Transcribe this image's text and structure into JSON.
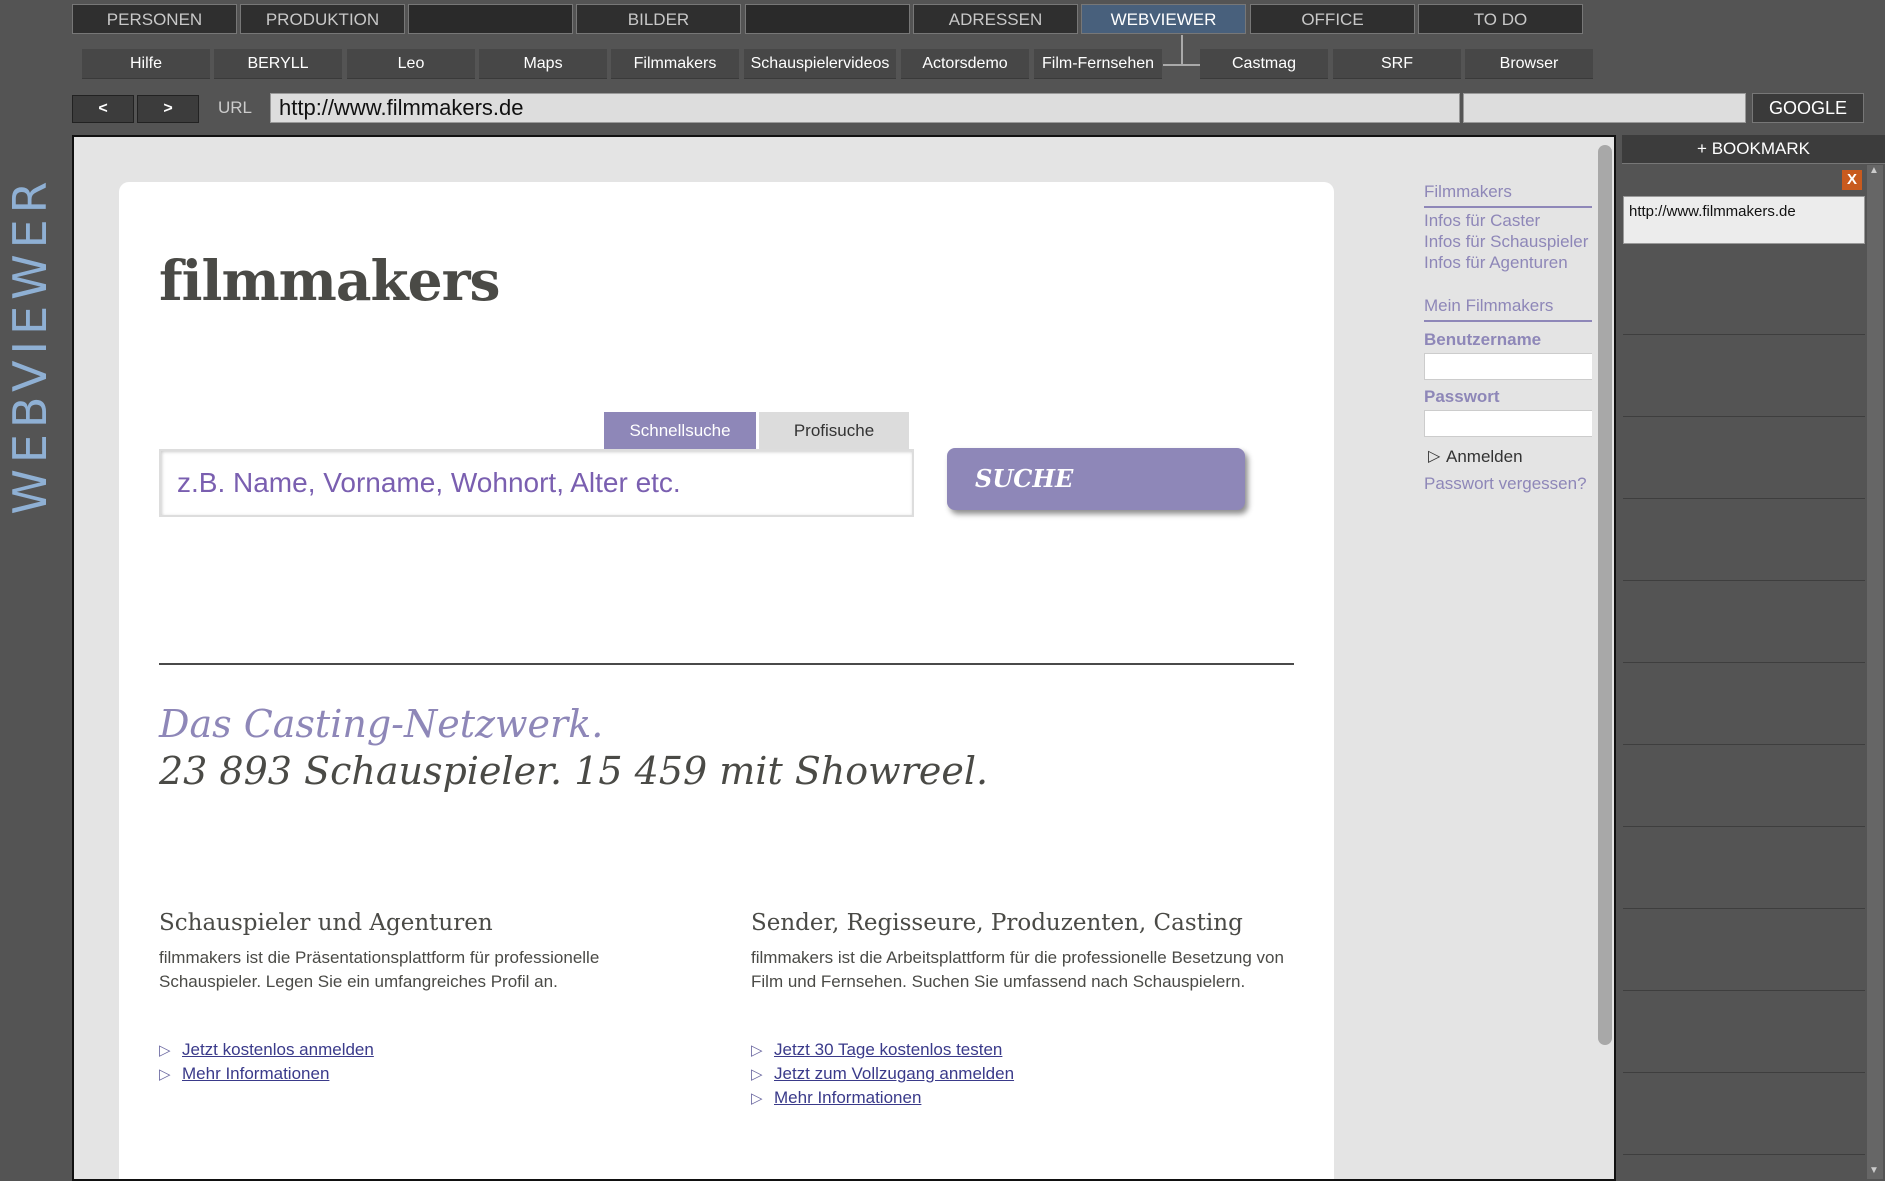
{
  "side_title": "WEBVIEWER",
  "main_tabs": [
    {
      "label": "PERSONEN"
    },
    {
      "label": "PRODUKTION"
    },
    {
      "label": ""
    },
    {
      "label": "BILDER"
    },
    {
      "label": ""
    },
    {
      "label": "ADRESSEN"
    },
    {
      "label": "WEBVIEWER",
      "active": true
    },
    {
      "label": "OFFICE"
    },
    {
      "label": "TO DO"
    }
  ],
  "sub_tabs": [
    {
      "label": "Hilfe"
    },
    {
      "label": "BERYLL"
    },
    {
      "label": "Leo"
    },
    {
      "label": "Maps"
    },
    {
      "label": "Filmmakers"
    },
    {
      "label": "Schauspielervideos"
    },
    {
      "label": "Actorsdemo"
    },
    {
      "label": "Film-Fernsehen"
    },
    {
      "label": "Castmag"
    },
    {
      "label": "SRF"
    },
    {
      "label": "Browser"
    }
  ],
  "nav": {
    "back": "<",
    "forward": ">",
    "url_label": "URL",
    "url_value": "http://www.filmmakers.de",
    "google_value": "",
    "google_button": "GOOGLE"
  },
  "page": {
    "logo": "filmmakers",
    "search_tabs": [
      "Schnellsuche",
      "Profisuche"
    ],
    "search_placeholder": "z.B. Name, Vorname, Wohnort, Alter etc.",
    "search_button": "SUCHE",
    "tagline_1": "Das Casting-Netzwerk.",
    "tagline_2": "23 893 Schauspieler. 15 459 mit Showreel.",
    "col1": {
      "heading": "Schauspieler und Agenturen",
      "text": "filmmakers ist die Präsentationsplattform für professionelle Schauspieler. Legen Sie ein umfangreiches Profil an.",
      "links": [
        "Jetzt kostenlos anmelden",
        "Mehr Informationen"
      ]
    },
    "col2": {
      "heading": "Sender, Regisseure, Produzenten, Casting",
      "text": "filmmakers ist die Arbeitsplattform für die professionelle Besetzung von Film und Fernsehen. Suchen Sie umfassend nach Schauspielern.",
      "links": [
        "Jetzt 30 Tage kostenlos testen",
        "Jetzt zum Vollzugang anmelden",
        "Mehr Informationen"
      ]
    },
    "sidebar": {
      "section1_title": "Filmmakers",
      "section1_links": [
        "Infos für Caster",
        "Infos für Schauspieler",
        "Infos für Agenturen"
      ],
      "section2_title": "Mein Filmmakers",
      "username_label": "Benutzername",
      "password_label": "Passwort",
      "login_link": "Anmelden",
      "forgot_link": "Passwort vergessen?"
    }
  },
  "bookmarks": {
    "add_label": "+ BOOKMARK",
    "close_label": "X",
    "items": [
      "http://www.filmmakers.de"
    ]
  },
  "colors": {
    "accent_purple": "#8e87b8",
    "active_tab": "#48607c",
    "side_title": "#8fb0d4"
  }
}
